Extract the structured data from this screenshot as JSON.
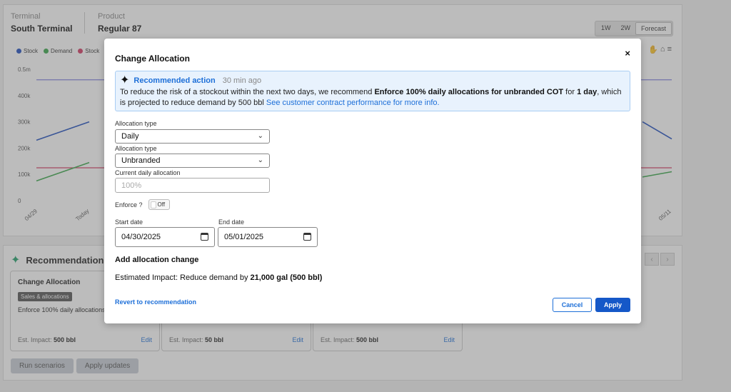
{
  "header": {
    "terminal_label": "Terminal",
    "terminal_value": "South Terminal",
    "product_label": "Product",
    "product_value": "Regular 87",
    "range_buttons": [
      "1W",
      "2W",
      "Forecast"
    ],
    "active_range": "Forecast"
  },
  "chart_data": {
    "type": "line",
    "legend": [
      {
        "name": "Stock",
        "color": "#1f4fbf"
      },
      {
        "name": "Demand",
        "color": "#3aa84a"
      },
      {
        "name": "Stock",
        "color": "#d23a63"
      }
    ],
    "y_ticks": [
      "0.5m",
      "400k",
      "300k",
      "200k",
      "100k",
      "0"
    ],
    "x_ticks_left": [
      "04/29",
      "Today"
    ],
    "x_ticks_right": [
      "05/11"
    ],
    "ylim": [
      0,
      500000
    ],
    "series": [
      {
        "name": "Stock",
        "color": "#1f4fbf",
        "left": [
          230000,
          300000
        ],
        "right": [
          300000,
          235000
        ]
      },
      {
        "name": "Demand",
        "color": "#3aa84a",
        "left": [
          75000,
          145000
        ],
        "right": [
          90000,
          110000
        ]
      }
    ],
    "reference_lines": [
      {
        "value": 460000,
        "color": "#8080e0"
      },
      {
        "value": 125000,
        "color": "#d23a63"
      }
    ]
  },
  "recommendations": {
    "title": "Recommendations",
    "cards": [
      {
        "title": "Change Allocation",
        "tag": "Sales & allocations",
        "desc": "Enforce 100% daily allocations ... COT",
        "impact_label": "Est. Impact:",
        "impact_value": "500 bbl",
        "edit": "Edit"
      },
      {
        "title": "",
        "tag": "",
        "desc": "",
        "impact_label": "Est. Impact:",
        "impact_value": "50 bbl",
        "edit": "Edit"
      },
      {
        "title": "",
        "tag": "",
        "desc": "",
        "impact_label": "Est. Impact:",
        "impact_value": "500 bbl",
        "edit": "Edit"
      }
    ],
    "run_scenarios": "Run scenarios",
    "apply_updates": "Apply updates"
  },
  "modal": {
    "title": "Change Allocation",
    "close": "×",
    "banner": {
      "title": "Recommended action",
      "time": "30 min ago",
      "text_1": "To reduce the risk of a stockout within the next two days, we recommend ",
      "text_bold_1": "Enforce 100% daily allocations for unbranded COT",
      "text_2": " for ",
      "text_bold_2": "1 day",
      "text_3": ", which is projected to reduce demand by 500 bbl ",
      "link": "See customer contract performance for more info."
    },
    "allocation_type_label_1": "Allocation type",
    "allocation_type_value_1": "Daily",
    "allocation_type_label_2": "Allocation type",
    "allocation_type_value_2": "Unbranded",
    "current_daily_label": "Current daily allocation",
    "current_daily_placeholder": "100%",
    "enforce_label": "Enforce ?",
    "enforce_state": "Off",
    "start_date_label": "Start date",
    "start_date_value": "04/30/2025",
    "end_date_label": "End date",
    "end_date_value": "05/01/2025",
    "add_change_title": "Add allocation change",
    "impact_prefix": "Estimated Impact: Reduce demand by ",
    "impact_value": "21,000 gal (500 bbl)",
    "revert": "Revert to recommendation",
    "cancel": "Cancel",
    "apply": "Apply"
  }
}
